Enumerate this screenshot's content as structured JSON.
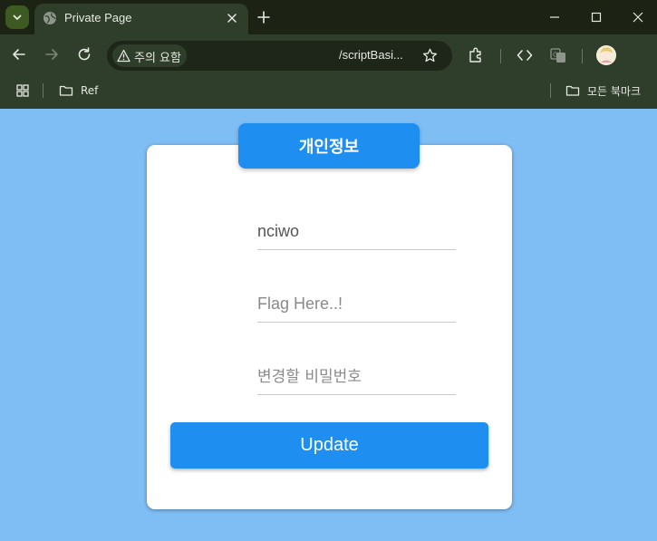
{
  "browser": {
    "tab": {
      "title": "Private Page",
      "favicon": "globe-icon"
    },
    "address_bar": {
      "security_label": "주의 요함",
      "url_text": "/scriptBasi...",
      "bookmark_star": "star-icon"
    },
    "bookmarks_bar": {
      "apps_icon": "apps-grid-icon",
      "items": [
        {
          "label": "Ref",
          "icon": "folder-icon"
        }
      ],
      "all_bookmarks_label": "모든 북마크"
    },
    "toolbar_icons": [
      "extensions-icon",
      "code-icon",
      "translate-icon",
      "avatar"
    ]
  },
  "page": {
    "header_title": "개인정보",
    "fields": {
      "username": {
        "value": "nciwo",
        "placeholder": ""
      },
      "flag": {
        "value": "",
        "placeholder": "Flag Here..!"
      },
      "new_password": {
        "value": "",
        "placeholder": "변경할 비밀번호"
      }
    },
    "submit_label": "Update"
  },
  "colors": {
    "page_background": "#7fbdf5",
    "accent": "#1f8ef1",
    "card_background": "#ffffff",
    "chrome_background": "#2f3d2b"
  }
}
